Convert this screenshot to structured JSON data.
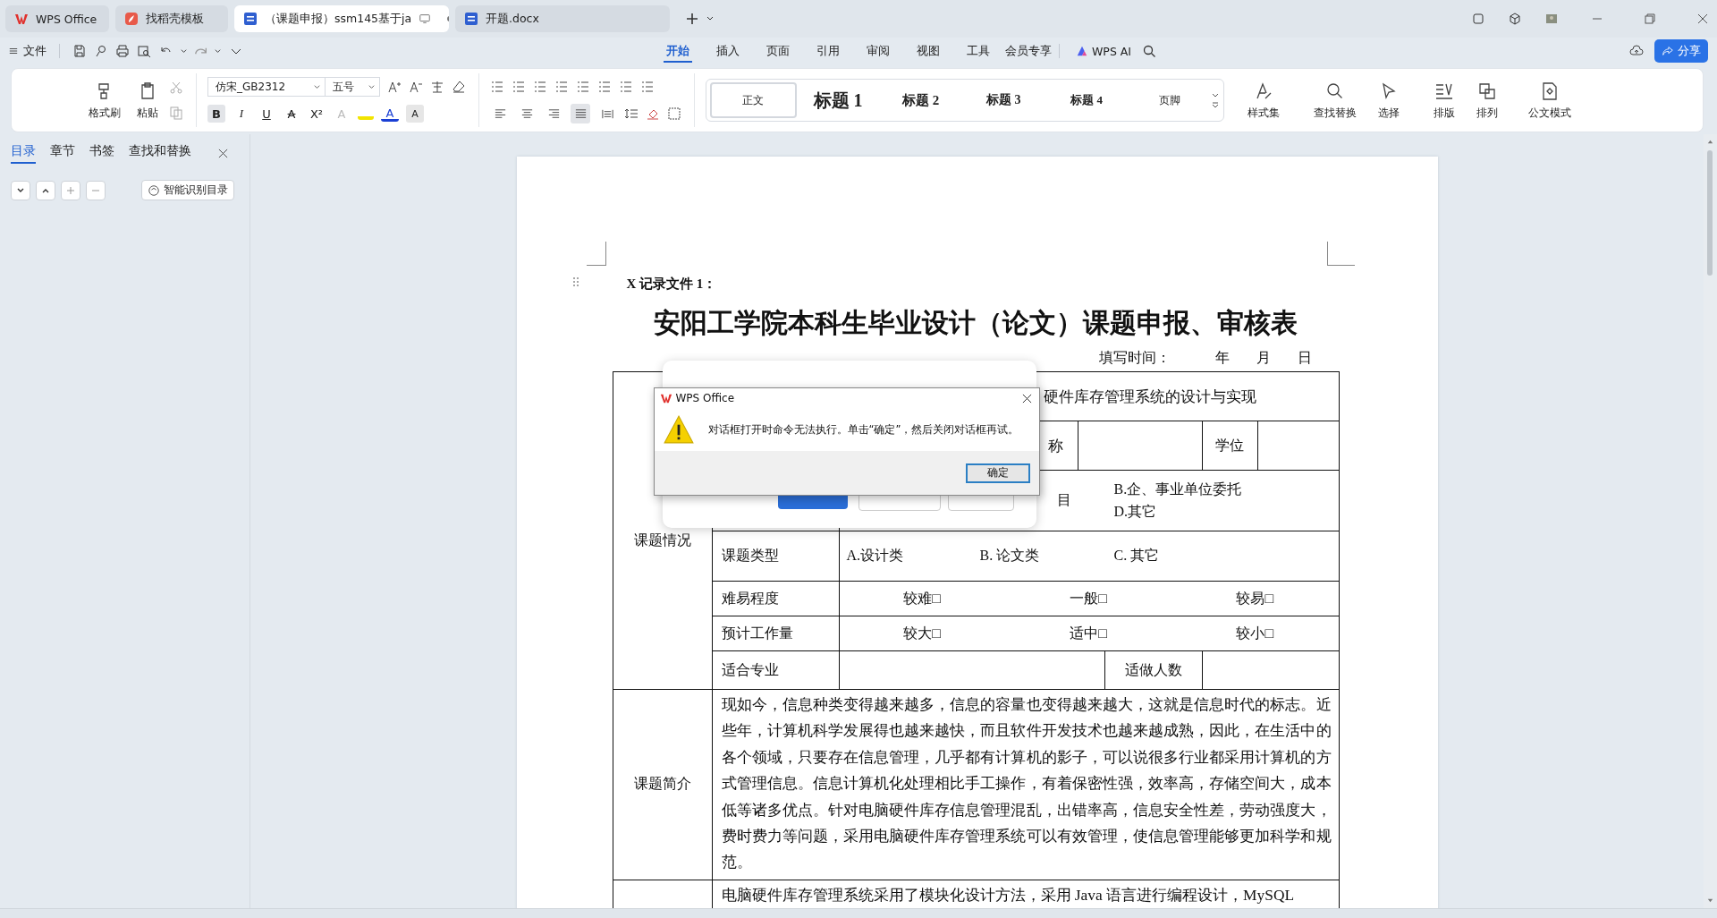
{
  "tabs": [
    {
      "label": "WPS Office",
      "kind": "home",
      "selected": false
    },
    {
      "label": "找稻壳模板",
      "kind": "template",
      "selected": false
    },
    {
      "label": "（课题申报）ssm145基于ja",
      "kind": "doc",
      "selected": true
    },
    {
      "label": "开题.docx",
      "kind": "doc",
      "selected": false
    }
  ],
  "file_menu": "文件",
  "menu": [
    {
      "label": "开始",
      "selected": true
    },
    {
      "label": "插入",
      "selected": false
    },
    {
      "label": "页面",
      "selected": false
    },
    {
      "label": "引用",
      "selected": false
    },
    {
      "label": "审阅",
      "selected": false
    },
    {
      "label": "视图",
      "selected": false
    },
    {
      "label": "工具",
      "selected": false
    },
    {
      "label": "会员专享",
      "selected": false
    }
  ],
  "ai": "WPS AI",
  "share": "分享",
  "ribbon": {
    "format_painter": "格式刷",
    "paste": "粘贴",
    "font": "仿宋_GB2312",
    "size": "五号",
    "format_buttons": [
      {
        "kind": "bold",
        "label": "B",
        "on": true
      },
      {
        "kind": "italic",
        "label": "I",
        "on": false
      },
      {
        "kind": "underline",
        "label": "U",
        "on": false
      },
      {
        "kind": "strike",
        "label": "A",
        "on": false
      },
      {
        "kind": "superscript",
        "label": "X²",
        "on": false
      },
      {
        "kind": "effect",
        "label": "A",
        "on": false
      },
      {
        "kind": "highlight",
        "on": false
      },
      {
        "kind": "color",
        "label": "A",
        "on": false
      },
      {
        "kind": "shade",
        "label": "A",
        "on": false
      }
    ],
    "align_buttons": [
      {
        "kind": "left",
        "selected": false
      },
      {
        "kind": "center",
        "selected": false
      },
      {
        "kind": "right",
        "selected": false
      },
      {
        "kind": "justify",
        "selected": true
      },
      {
        "kind": "distributed",
        "selected": false
      }
    ],
    "styles": [
      {
        "label": "正文",
        "kind": "body"
      },
      {
        "label": "标题 1",
        "kind": "h1"
      },
      {
        "label": "标题 2",
        "kind": "h2"
      },
      {
        "label": "标题 3",
        "kind": "h3"
      },
      {
        "label": "标题 4",
        "kind": "h4"
      },
      {
        "label": "页脚",
        "kind": "footer"
      }
    ],
    "tools": [
      {
        "label": "样式集",
        "kind": "styleset"
      },
      {
        "label": "查找替换",
        "kind": "find"
      },
      {
        "label": "选择",
        "kind": "select"
      },
      {
        "label": "排版",
        "kind": "layout"
      },
      {
        "label": "排列",
        "kind": "arrange"
      },
      {
        "label": "公文模式",
        "kind": "official"
      }
    ]
  },
  "sidebar": {
    "tabs": [
      {
        "label": "目录",
        "selected": true
      },
      {
        "label": "章节",
        "selected": false
      },
      {
        "label": "书签",
        "selected": false
      },
      {
        "label": "查找和替换",
        "selected": false
      }
    ],
    "smart_button": "智能识别目录"
  },
  "document": {
    "header_note": "X 记录文件 1：",
    "title": "安阳工学院本科生毕业设计（论文）课题申报、审核表",
    "date_line": [
      "填写时间：",
      "年",
      "月",
      "日"
    ],
    "sections": [
      {
        "label": "课题情况",
        "rows": [
          {
            "kind": "title",
            "cells": [
              {},
              {
                "text": "硬件库存管理系统的设计与实现"
              }
            ]
          },
          {
            "kind": "rank",
            "cells": [
              {
                "text": "称"
              },
              {},
              {
                "text": "学位"
              },
              {}
            ]
          },
          {
            "kind": "source",
            "cells": [
              {},
              {
                "text": "目"
              },
              {
                "lines": [
                  "B.企、事业单位委托",
                  "D.其它"
                ]
              }
            ]
          },
          {
            "kind": "type",
            "cells": [
              {
                "text": "课题类型"
              },
              {
                "text": "A.设计类"
              },
              {
                "text": "B.  论文类"
              },
              {
                "text": "C.  其它"
              }
            ]
          },
          {
            "kind": "check",
            "cells": [
              {
                "text": "难易程度"
              },
              {
                "text": "较难□"
              },
              {
                "text": "一般□"
              },
              {
                "text": "较易□"
              }
            ]
          },
          {
            "kind": "check",
            "cells": [
              {
                "text": "预计工作量"
              },
              {
                "text": "较大□"
              },
              {
                "text": "适中□"
              },
              {
                "text": "较小□"
              }
            ]
          },
          {
            "kind": "major",
            "cells": [
              {
                "text": "适合专业"
              },
              {},
              {
                "text": "适做人数"
              },
              {}
            ]
          }
        ]
      },
      {
        "label": "课题简介",
        "rows": [
          {
            "kind": "text",
            "cells": [
              {
                "text": "现如今，信息种类变得越来越多，信息的容量也变得越来越大，这就是信息时代的标志。近些年，计算机科学发展得也越来越快，而且软件开发技术也越来越成熟，因此，在生活中的各个领域，只要存在信息管理，几乎都有计算机的影子，可以说很多行业都采用计算机的方式管理信息。信息计算机化处理相比手工操作，有着保密性强，效率高，存储空间大，成本低等诸多优点。针对电脑硬件库存信息管理混乱，出错率高，信息安全性差，劳动强度大，费时费力等问题，采用电脑硬件库存管理系统可以有效管理，使信息管理能够更加科学和规范。"
              }
            ]
          }
        ]
      },
      {
        "rows": [
          {
            "kind": "text",
            "cells": [
              {
                "text": "电脑硬件库存管理系统采用了模块化设计方法，采用 Java 语言进行编程设计，MySQL"
              }
            ]
          }
        ]
      }
    ]
  },
  "dialog": {
    "title": "WPS Office",
    "message": "对话框打开时命令无法执行。单击“确定”，然后关闭对话框再试。",
    "button": "确定"
  }
}
